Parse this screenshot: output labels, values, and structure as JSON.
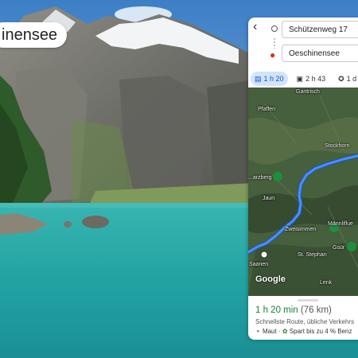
{
  "title_chip": {
    "text": "inensee"
  },
  "maps": {
    "origin": "Schützenweg 17",
    "destination": "Oeschinensee",
    "modes": [
      {
        "icon": "car-icon",
        "label": "1 h 20",
        "active": true
      },
      {
        "icon": "train-icon",
        "label": "2 h 43",
        "active": false
      },
      {
        "icon": "walk-icon",
        "label": "1 d",
        "active": false
      }
    ],
    "map_labels": {
      "pfaffen": "Pfaffen",
      "gantrisch": "Gantrisch",
      "stockhorn": "Stockhorn",
      "jaun": "Jaun",
      "zweisimmen": "Zweisimmen",
      "mannlifluh": "Männliflue",
      "st_stephan": "St. Stephan",
      "gsur": "Gsür",
      "lenk": "Lenk",
      "saanen": "Saanen",
      "schwarzberg": "...arzberg",
      "brand": "Google"
    },
    "summary": {
      "duration": "1 h 20 min",
      "distance": "(76 km)",
      "description": "Schnellste Route, übliche Verkehrs",
      "toll": "Maut",
      "eco": "Spart bis zu 4 % Benz"
    },
    "colors": {
      "route": "#4285f4",
      "active_mode_bg": "#d2e3fc",
      "duration": "#188038"
    }
  }
}
